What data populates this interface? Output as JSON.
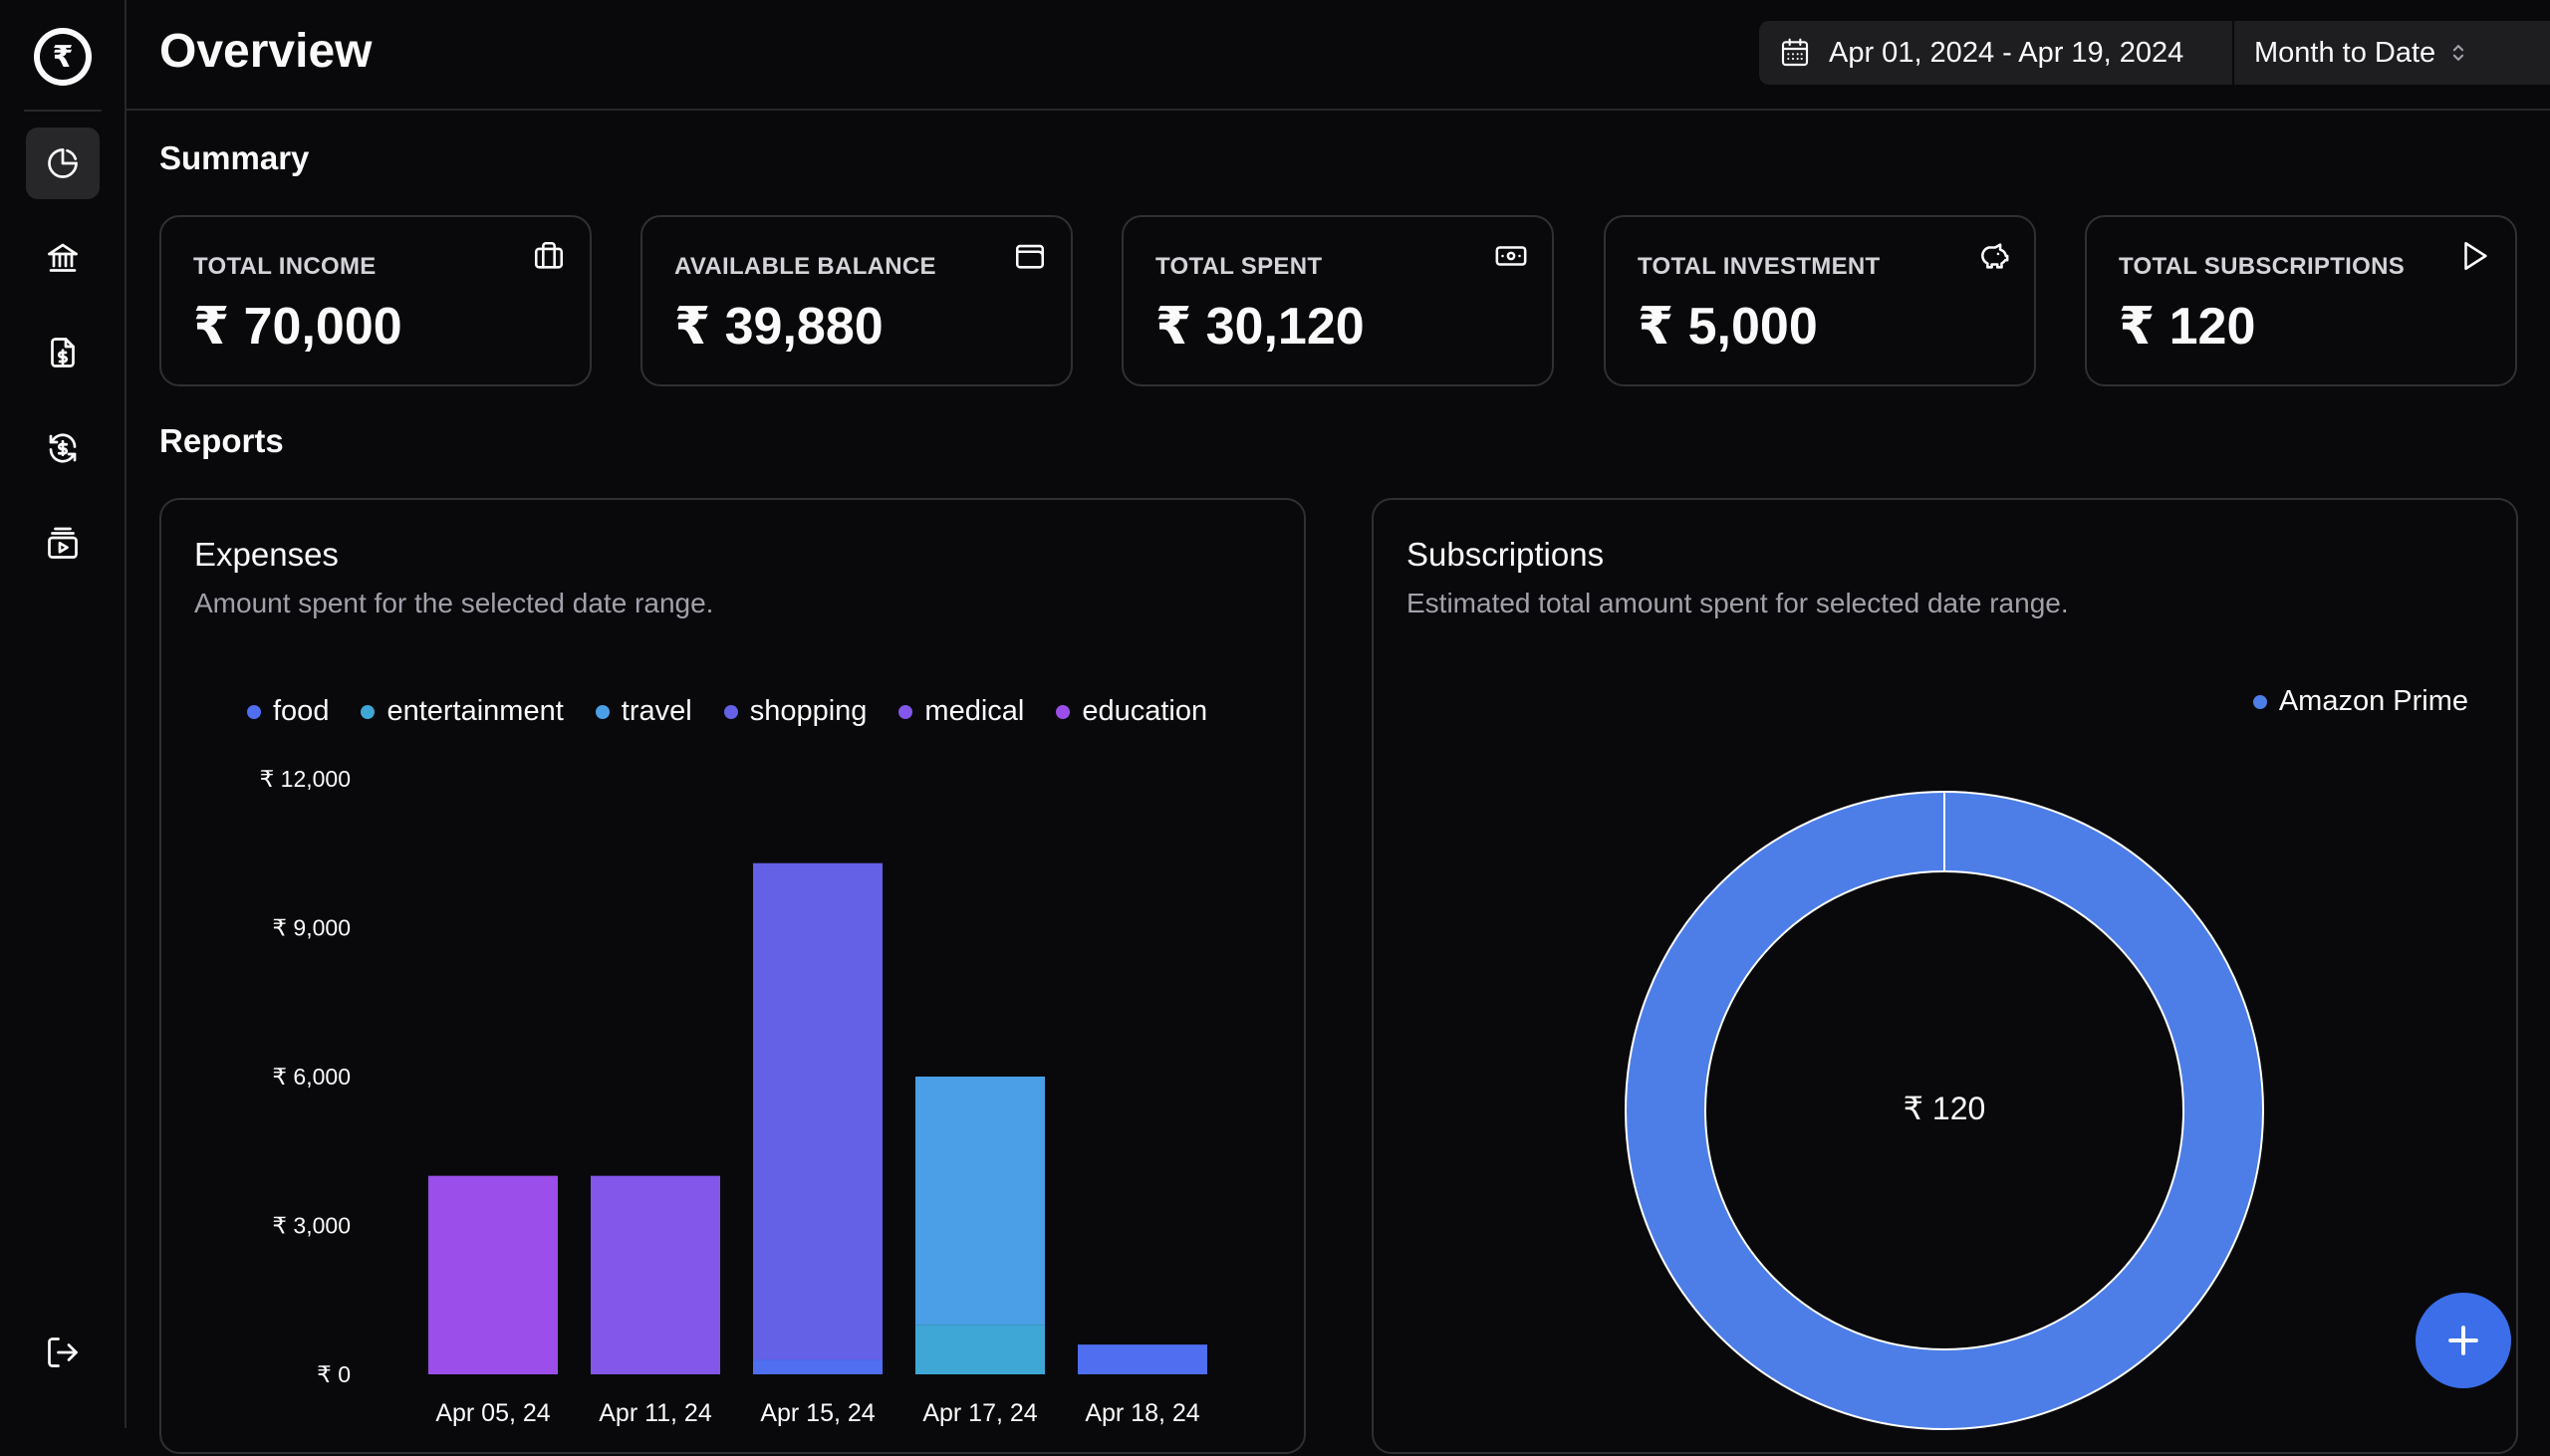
{
  "app": {
    "currency_symbol": "₹"
  },
  "header": {
    "title": "Overview",
    "date_range": "Apr 01, 2024 - Apr 19, 2024",
    "preset": "Month to Date"
  },
  "sidebar": {
    "items": [
      {
        "icon": "chart-pie-icon",
        "active": true
      },
      {
        "icon": "bank-icon",
        "active": false
      },
      {
        "icon": "invoice-icon",
        "active": false
      },
      {
        "icon": "currency-exchange-icon",
        "active": false
      },
      {
        "icon": "subscription-icon",
        "active": false
      }
    ],
    "logout_icon": "logout-icon"
  },
  "summary": {
    "title": "Summary",
    "cards": [
      {
        "label": "TOTAL INCOME",
        "value": "₹ 70,000",
        "icon": "briefcase-icon"
      },
      {
        "label": "AVAILABLE BALANCE",
        "value": "₹ 39,880",
        "icon": "wallet-icon"
      },
      {
        "label": "TOTAL SPENT",
        "value": "₹ 30,120",
        "icon": "banknote-icon"
      },
      {
        "label": "TOTAL INVESTMENT",
        "value": "₹ 5,000",
        "icon": "piggy-bank-icon"
      },
      {
        "label": "TOTAL SUBSCRIPTIONS",
        "value": "₹ 120",
        "icon": "play-icon"
      }
    ]
  },
  "reports": {
    "title": "Reports",
    "expenses": {
      "title": "Expenses",
      "description": "Amount spent for the selected date range."
    },
    "subscriptions": {
      "title": "Subscriptions",
      "description": "Estimated total amount spent for selected date range.",
      "center_label": "₹ 120"
    }
  },
  "colors": {
    "food": "#4f6ef0",
    "entertainment": "#3fa7d6",
    "travel": "#4a9fe6",
    "shopping": "#6461e6",
    "medical": "#8257e9",
    "education": "#9b4ee9",
    "amazon_prime": "#4d7ee8",
    "accent": "#3b6ee8"
  },
  "chart_data": [
    {
      "type": "bar",
      "stacked": true,
      "categories": [
        "Apr 05, 24",
        "Apr 11, 24",
        "Apr 15, 24",
        "Apr 17, 24",
        "Apr 18, 24"
      ],
      "series": [
        {
          "name": "food",
          "values": [
            0,
            0,
            0,
            0,
            600
          ]
        },
        {
          "name": "entertainment",
          "values": [
            0,
            0,
            0,
            1000,
            0
          ]
        },
        {
          "name": "travel",
          "values": [
            0,
            0,
            0,
            5000,
            0
          ]
        },
        {
          "name": "shopping",
          "values": [
            0,
            0,
            10000,
            0,
            0
          ]
        },
        {
          "name": "medical",
          "values": [
            0,
            4000,
            0,
            0,
            0
          ]
        },
        {
          "name": "education",
          "values": [
            4000,
            0,
            0,
            0,
            0
          ]
        }
      ],
      "extra_segment": {
        "category": "Apr 15, 24",
        "series": "food",
        "value": 300
      },
      "yticks": [
        "₹ 0",
        "₹ 3,000",
        "₹ 6,000",
        "₹ 9,000",
        "₹ 12,000"
      ],
      "ytick_values": [
        0,
        3000,
        6000,
        9000,
        12000
      ],
      "ylim": [
        0,
        12000
      ],
      "legend_position": "top"
    },
    {
      "type": "pie",
      "donut": true,
      "labels": [
        "Amazon Prime"
      ],
      "values": [
        120
      ],
      "legend_position": "top-right"
    }
  ]
}
